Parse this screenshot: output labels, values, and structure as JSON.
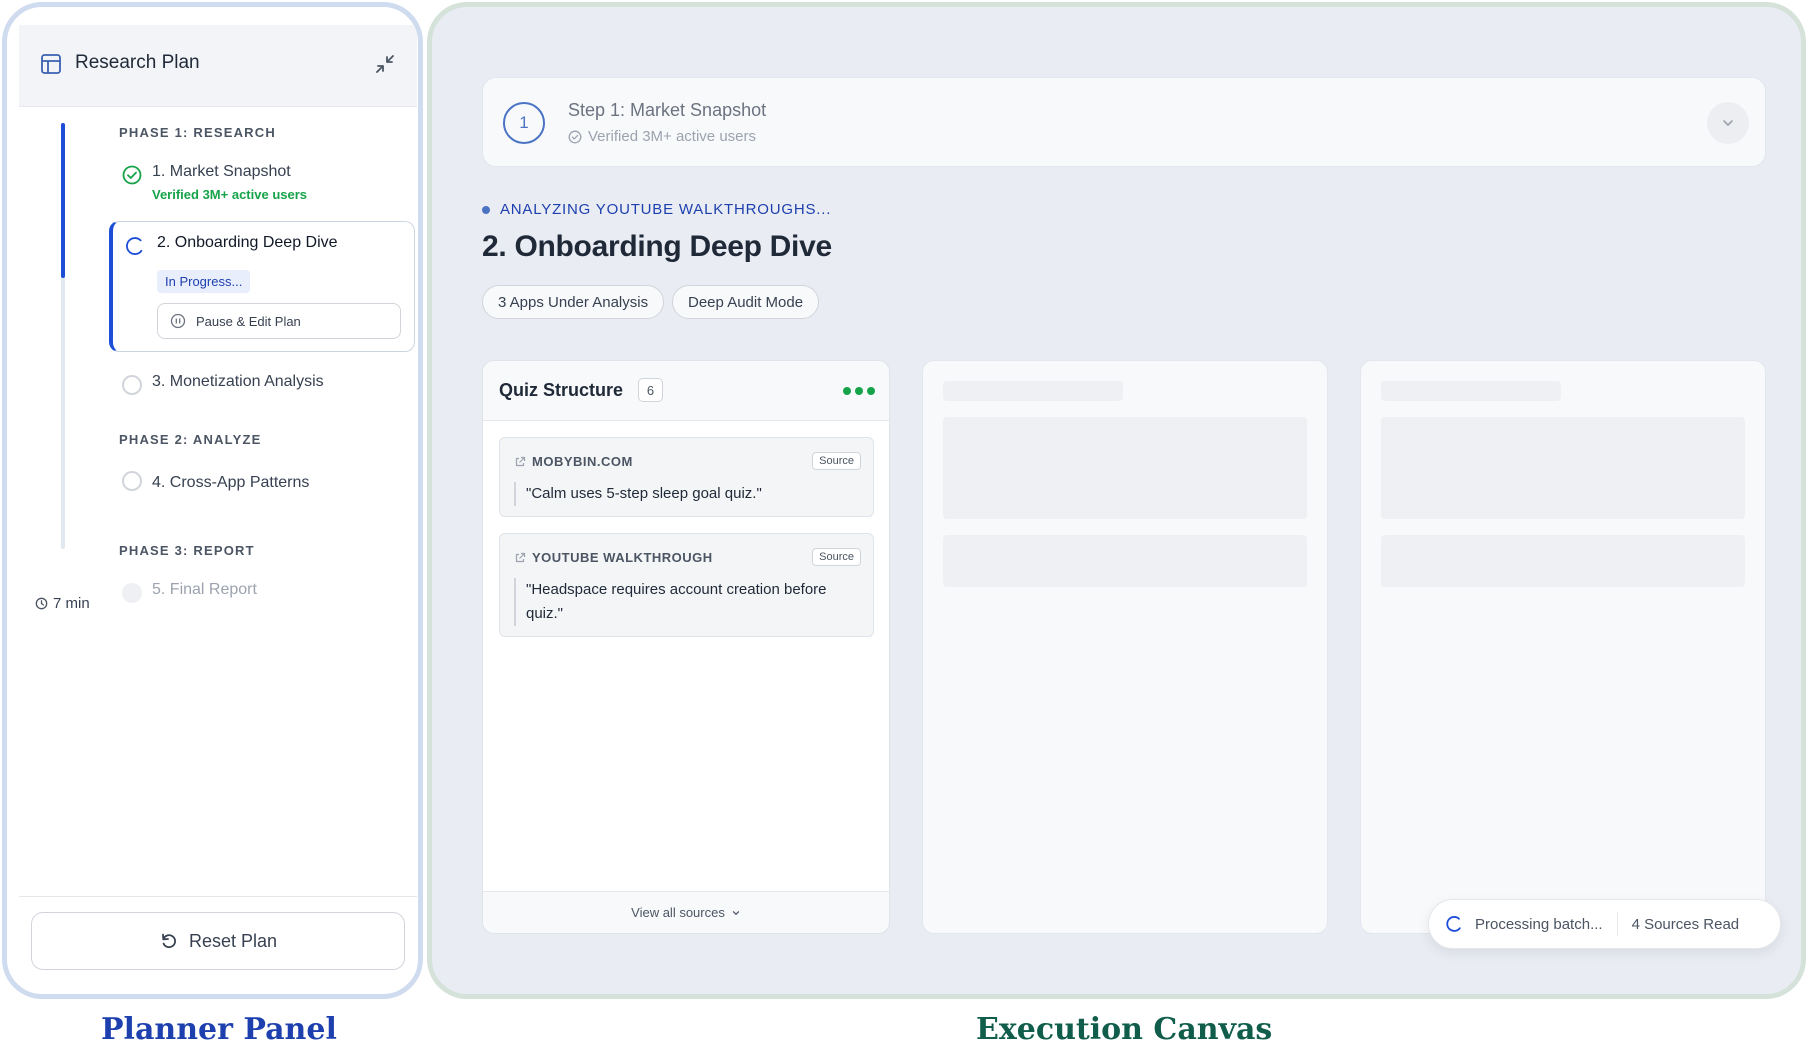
{
  "planner": {
    "title": "Research Plan",
    "time_estimate": "7 min",
    "phases": [
      {
        "label": "PHASE 1: RESEARCH"
      },
      {
        "label": "PHASE 2: ANALYZE"
      },
      {
        "label": "PHASE 3: REPORT"
      }
    ],
    "steps": [
      {
        "name": "1. Market Snapshot",
        "status": "done",
        "sub": "Verified 3M+ active users"
      },
      {
        "name": "2. Onboarding Deep Dive",
        "status": "in_progress",
        "badge": "In Progress...",
        "action": "Pause & Edit Plan"
      },
      {
        "name": "3. Monetization Analysis",
        "status": "pending"
      },
      {
        "name": "4. Cross-App Patterns",
        "status": "pending"
      },
      {
        "name": "5. Final Report",
        "status": "locked"
      }
    ],
    "reset_label": "Reset Plan"
  },
  "canvas": {
    "previous_step": {
      "number": "1",
      "title": "Step 1: Market Snapshot",
      "note": "Verified 3M+ active users"
    },
    "status": "ANALYZING YOUTUBE WALKTHROUGHS...",
    "title": "2. Onboarding Deep Dive",
    "chips": [
      "3 Apps Under Analysis",
      "Deep Audit Mode"
    ],
    "quiz_card": {
      "title": "Quiz Structure",
      "count": "6",
      "sources": [
        {
          "domain": "MOBYBIN.COM",
          "tag": "Source",
          "quote": "\"Calm uses 5-step sleep goal quiz.\""
        },
        {
          "domain": "YOUTUBE WALKTHROUGH",
          "tag": "Source",
          "quote": "\"Headspace requires account creation before quiz.\""
        }
      ],
      "footer": "View all sources"
    },
    "processing": {
      "label": "Processing batch...",
      "sources_read": "4 Sources Read"
    }
  },
  "captions": {
    "planner": "Planner Panel",
    "canvas": "Execution Canvas"
  },
  "colors": {
    "accent_blue": "#1d4ed8",
    "success_green": "#16a34a",
    "planner_border": "#cfdbef",
    "canvas_border": "#d4e2da",
    "canvas_bg": "#e9ecf3"
  }
}
